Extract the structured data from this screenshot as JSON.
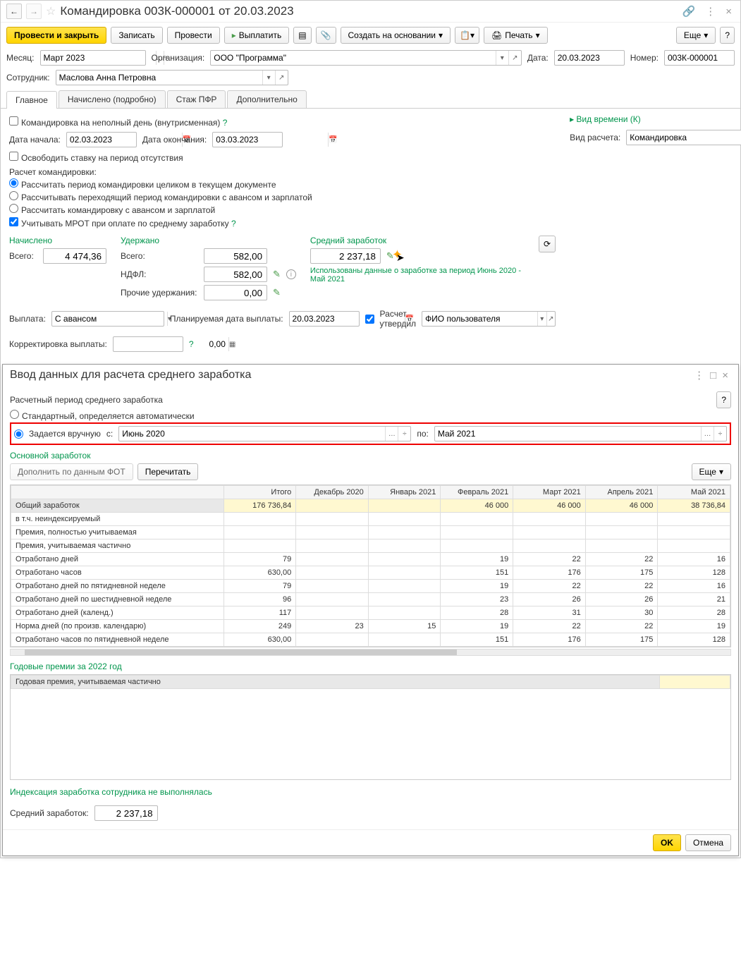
{
  "header": {
    "title": "Командировка 003К-000001 от 20.03.2023"
  },
  "toolbar": {
    "post_close": "Провести и закрыть",
    "save": "Записать",
    "post": "Провести",
    "pay": "Выплатить",
    "create_based": "Создать на основании",
    "print": "Печать",
    "more": "Еще"
  },
  "form": {
    "month_label": "Месяц:",
    "month_value": "Март 2023",
    "org_label": "Организация:",
    "org_value": "ООО \"Программа\"",
    "date_label": "Дата:",
    "date_value": "20.03.2023",
    "number_label": "Номер:",
    "number_value": "003К-000001",
    "employee_label": "Сотрудник:",
    "employee_value": "Маслова Анна Петровна"
  },
  "tabs": {
    "main": "Главное",
    "accrued": "Начислено (подробно)",
    "pfr": "Стаж ПФР",
    "additional": "Дополнительно"
  },
  "main": {
    "partial_day": "Командировка на неполный день (внутрисменная)",
    "start_label": "Дата начала:",
    "start_value": "02.03.2023",
    "end_label": "Дата окончания:",
    "end_value": "03.03.2023",
    "free_rate": "Освободить ставку на период отсутствия",
    "calc_title": "Расчет командировки:",
    "radio1": "Рассчитать период командировки целиком в текущем документе",
    "radio2": "Рассчитывать переходящий период командировки с авансом и зарплатой",
    "radio3": "Рассчитать командировку с авансом и зарплатой",
    "mrot": "Учитывать МРОТ при оплате по среднему заработку",
    "time_kind_section": "Вид времени (К)",
    "calc_kind_label": "Вид расчета:",
    "calc_kind_value": "Командировка"
  },
  "amounts": {
    "accrued_title": "Начислено",
    "withheld_title": "Удержано",
    "avg_title": "Средний заработок",
    "total_label": "Всего:",
    "accrued_total": "4 474,36",
    "withheld_total": "582,00",
    "ndfl_label": "НДФЛ:",
    "ndfl_value": "582,00",
    "other_label": "Прочие удержания:",
    "other_value": "0,00",
    "avg_value": "2 237,18",
    "avg_info": "Использованы данные о заработке за период Июнь 2020 - Май 2021"
  },
  "payment": {
    "label": "Выплата:",
    "value": "С авансом",
    "planned_label": "Планируемая дата выплаты:",
    "planned_value": "20.03.2023",
    "approved_label": "Расчет утвердил",
    "approved_value": "ФИО пользователя",
    "correction_label": "Корректировка выплаты:",
    "correction_value": "0,00"
  },
  "modal": {
    "title": "Ввод данных для расчета среднего заработка",
    "period_title": "Расчетный период среднего заработка",
    "radio_std": "Стандартный, определяется автоматически",
    "radio_manual": "Задается вручную",
    "from_label": "с:",
    "from_value": "Июнь 2020",
    "to_label": "по:",
    "to_value": "Май 2021",
    "main_earnings": "Основной заработок",
    "fill_fot": "Дополнить по данным ФОТ",
    "recalc": "Перечитать",
    "more": "Еще",
    "columns": [
      "",
      "Итого",
      "Декабрь 2020",
      "Январь 2021",
      "Февраль 2021",
      "Март 2021",
      "Апрель 2021",
      "Май 2021"
    ],
    "rows": [
      {
        "label": "Общий заработок",
        "total": "176 736,84",
        "cells": [
          "",
          "",
          "46 000",
          "46 000",
          "46 000",
          "38 736,84"
        ],
        "highlight": true,
        "selected": true
      },
      {
        "label": "   в т.ч. неиндексируемый",
        "total": "",
        "cells": [
          "",
          "",
          "",
          "",
          "",
          ""
        ]
      },
      {
        "label": "Премия, полностью учитываемая",
        "total": "",
        "cells": [
          "",
          "",
          "",
          "",
          "",
          ""
        ]
      },
      {
        "label": "Премия, учитываемая частично",
        "total": "",
        "cells": [
          "",
          "",
          "",
          "",
          "",
          ""
        ]
      },
      {
        "label": "Отработано дней",
        "total": "79",
        "cells": [
          "",
          "",
          "19",
          "22",
          "22",
          "16"
        ]
      },
      {
        "label": "Отработано часов",
        "total": "630,00",
        "cells": [
          "",
          "",
          "151",
          "176",
          "175",
          "128"
        ]
      },
      {
        "label": "Отработано дней по пятидневной неделе",
        "total": "79",
        "cells": [
          "",
          "",
          "19",
          "22",
          "22",
          "16"
        ]
      },
      {
        "label": "Отработано дней по шестидневной неделе",
        "total": "96",
        "cells": [
          "",
          "",
          "23",
          "26",
          "26",
          "21"
        ]
      },
      {
        "label": "Отработано дней (календ.)",
        "total": "117",
        "cells": [
          "",
          "",
          "28",
          "31",
          "30",
          "28"
        ]
      },
      {
        "label": "Норма дней (по произв. календарю)",
        "total": "249",
        "cells": [
          "23",
          "15",
          "19",
          "22",
          "22",
          "19"
        ]
      },
      {
        "label": "Отработано часов по пятидневной неделе",
        "total": "630,00",
        "cells": [
          "",
          "",
          "151",
          "176",
          "175",
          "128"
        ]
      }
    ],
    "annual_title": "Годовые премии за 2022 год",
    "annual_row": "Годовая премия, учитываемая частично",
    "indexation": "Индексация заработка сотрудника не выполнялась",
    "avg_label": "Средний заработок:",
    "avg_value": "2 237,18",
    "ok": "OK",
    "cancel": "Отмена"
  }
}
